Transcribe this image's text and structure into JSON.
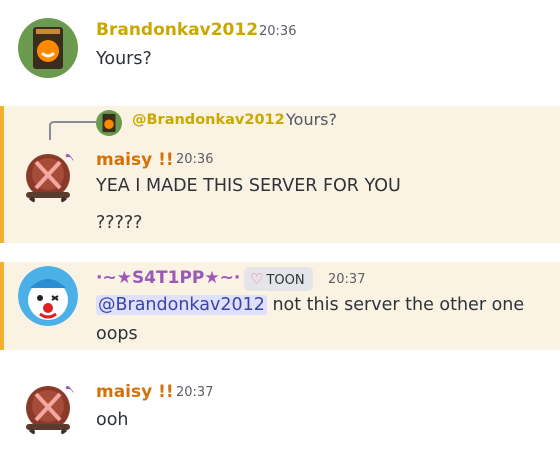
{
  "messages": [
    {
      "username": "Brandonkav2012",
      "time": "20:36",
      "lines": [
        "Yours?"
      ]
    },
    {
      "reply": {
        "username": "@Brandonkav2012",
        "text": "Yours?"
      },
      "username": "maisy !!",
      "time": "20:36",
      "lines": [
        "YEA I MADE THIS SERVER FOR YOU",
        "?????"
      ]
    },
    {
      "username": "·~★S4T1PP★~·",
      "badge": "TOON",
      "time": "20:37",
      "mention": "@Brandonkav2012",
      "line1_rest": " not this server the other one",
      "line2": "oops"
    },
    {
      "username": "maisy !!",
      "time": "20:37",
      "lines": [
        "ooh"
      ]
    }
  ],
  "colors": {
    "brandon": "#c9a800",
    "maisy": "#d4720a",
    "satipp": "#9b59b6",
    "highlight_bg": "#faf3e3",
    "highlight_bar": "#f0b232",
    "mention_bg": "#dee0fc"
  },
  "icons": [
    "orange-avatar-icon",
    "crossed-turtle-avatar-icon",
    "clown-avatar-icon",
    "heart-icon",
    "reply-line-icon"
  ]
}
